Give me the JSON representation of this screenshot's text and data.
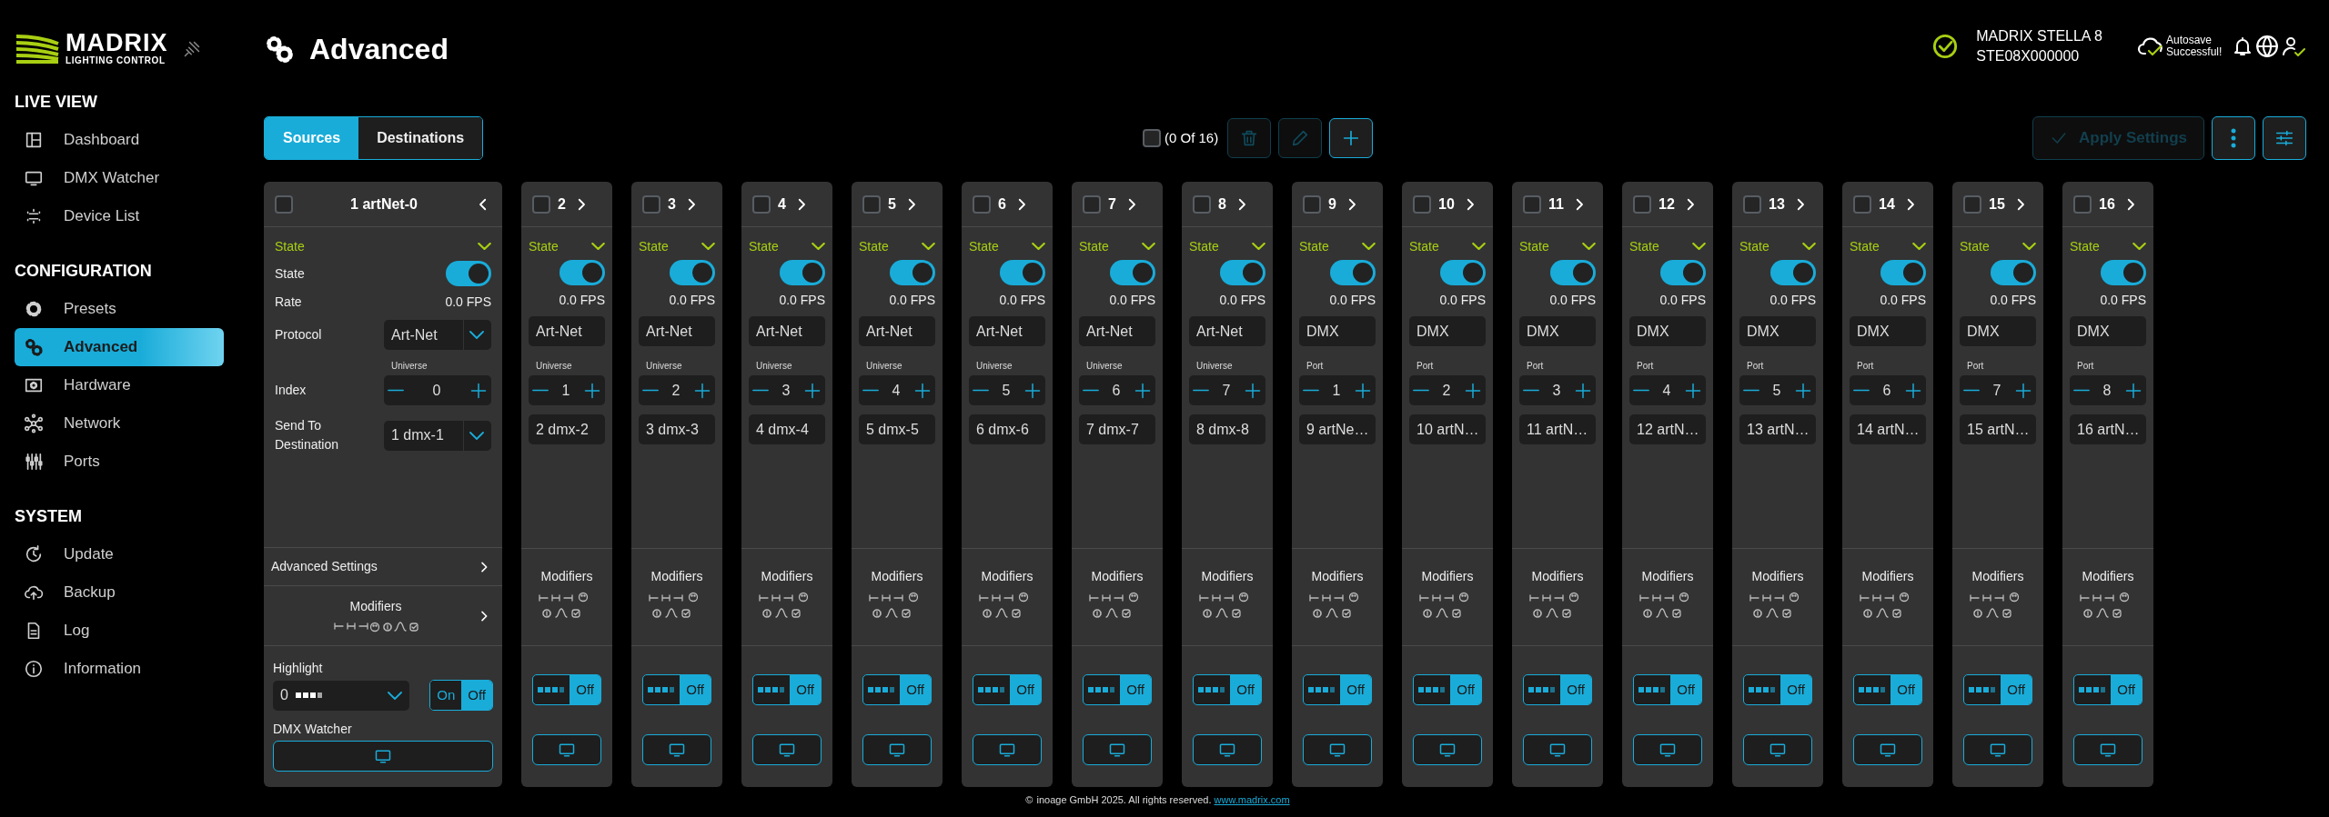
{
  "sidebar": {
    "logo": {
      "name": "MADRIX",
      "tagline": "LIGHTING CONTROL"
    },
    "sections": [
      {
        "title": "LIVE VIEW",
        "items": [
          {
            "label": "Dashboard",
            "selected": false
          },
          {
            "label": "DMX Watcher",
            "selected": false
          },
          {
            "label": "Device List",
            "selected": false
          }
        ]
      },
      {
        "title": "CONFIGURATION",
        "items": [
          {
            "label": "Presets",
            "selected": false
          },
          {
            "label": "Advanced",
            "selected": true
          },
          {
            "label": "Hardware",
            "selected": false
          },
          {
            "label": "Network",
            "selected": false
          },
          {
            "label": "Ports",
            "selected": false
          }
        ]
      },
      {
        "title": "SYSTEM",
        "items": [
          {
            "label": "Update",
            "selected": false
          },
          {
            "label": "Backup",
            "selected": false
          },
          {
            "label": "Log",
            "selected": false
          },
          {
            "label": "Information",
            "selected": false
          }
        ]
      }
    ]
  },
  "page": {
    "title": "Advanced"
  },
  "device": {
    "name": "MADRIX STELLA 8",
    "serial": "STE08X000000"
  },
  "autosave": "Autosave Successful!",
  "tabs": [
    {
      "label": "Sources",
      "selected": true
    },
    {
      "label": "Destinations",
      "selected": false
    }
  ],
  "selection": {
    "checked": false,
    "count": "(0 Of 16)"
  },
  "toolbar_buttons": [
    {
      "kind": "delete",
      "disabled": true
    },
    {
      "kind": "edit",
      "disabled": true
    },
    {
      "kind": "add",
      "disabled": false
    }
  ],
  "apply_button": {
    "label": "Apply Settings",
    "disabled": true
  },
  "columns": [
    {
      "title": "1 artNet-0",
      "expanded": true,
      "checked": false,
      "section": "State",
      "state_label": "State",
      "state_on": true,
      "rate_label": "Rate",
      "rate": "0.0 FPS",
      "protocol_label": "Protocol",
      "protocol": "Art-Net",
      "index_label": "Index",
      "index_unit": "Universe",
      "index": "0",
      "destination_label": "Send To Destination",
      "destination": "1 dmx-1",
      "advanced_label": "Advanced Settings",
      "modifiers": "Modifiers",
      "highlight_label": "Highlight",
      "highlight_value": "0",
      "highlight": [
        {
          "label": "On",
          "selected": false
        },
        {
          "label": "Off",
          "selected": true
        }
      ],
      "watcher_label": "DMX Watcher"
    },
    {
      "title": "2",
      "expanded": false,
      "checked": false,
      "section": "State",
      "state_on": true,
      "rate": "0.0 FPS",
      "protocol": "Art-Net",
      "index_unit": "Universe",
      "index": "1",
      "destination": "2 dmx-2",
      "modifiers": "Modifiers",
      "highlight": [
        {
          "label": "Off",
          "selected": true
        }
      ]
    },
    {
      "title": "3",
      "expanded": false,
      "checked": false,
      "section": "State",
      "state_on": true,
      "rate": "0.0 FPS",
      "protocol": "Art-Net",
      "index_unit": "Universe",
      "index": "2",
      "destination": "3 dmx-3",
      "modifiers": "Modifiers",
      "highlight": [
        {
          "label": "Off",
          "selected": true
        }
      ]
    },
    {
      "title": "4",
      "expanded": false,
      "checked": false,
      "section": "State",
      "state_on": true,
      "rate": "0.0 FPS",
      "protocol": "Art-Net",
      "index_unit": "Universe",
      "index": "3",
      "destination": "4 dmx-4",
      "modifiers": "Modifiers",
      "highlight": [
        {
          "label": "Off",
          "selected": true
        }
      ]
    },
    {
      "title": "5",
      "expanded": false,
      "checked": false,
      "section": "State",
      "state_on": true,
      "rate": "0.0 FPS",
      "protocol": "Art-Net",
      "index_unit": "Universe",
      "index": "4",
      "destination": "5 dmx-5",
      "modifiers": "Modifiers",
      "highlight": [
        {
          "label": "Off",
          "selected": true
        }
      ]
    },
    {
      "title": "6",
      "expanded": false,
      "checked": false,
      "section": "State",
      "state_on": true,
      "rate": "0.0 FPS",
      "protocol": "Art-Net",
      "index_unit": "Universe",
      "index": "5",
      "destination": "6 dmx-6",
      "modifiers": "Modifiers",
      "highlight": [
        {
          "label": "Off",
          "selected": true
        }
      ]
    },
    {
      "title": "7",
      "expanded": false,
      "checked": false,
      "section": "State",
      "state_on": true,
      "rate": "0.0 FPS",
      "protocol": "Art-Net",
      "index_unit": "Universe",
      "index": "6",
      "destination": "7 dmx-7",
      "modifiers": "Modifiers",
      "highlight": [
        {
          "label": "Off",
          "selected": true
        }
      ]
    },
    {
      "title": "8",
      "expanded": false,
      "checked": false,
      "section": "State",
      "state_on": true,
      "rate": "0.0 FPS",
      "protocol": "Art-Net",
      "index_unit": "Universe",
      "index": "7",
      "destination": "8 dmx-8",
      "modifiers": "Modifiers",
      "highlight": [
        {
          "label": "Off",
          "selected": true
        }
      ]
    },
    {
      "title": "9",
      "expanded": false,
      "checked": false,
      "section": "State",
      "state_on": true,
      "rate": "0.0 FPS",
      "protocol": "DMX",
      "index_unit": "Port",
      "index": "1",
      "destination": "9 artNe…",
      "modifiers": "Modifiers",
      "highlight": [
        {
          "label": "Off",
          "selected": true
        }
      ]
    },
    {
      "title": "10",
      "expanded": false,
      "checked": false,
      "section": "State",
      "state_on": true,
      "rate": "0.0 FPS",
      "protocol": "DMX",
      "index_unit": "Port",
      "index": "2",
      "destination": "10 artN…",
      "modifiers": "Modifiers",
      "highlight": [
        {
          "label": "Off",
          "selected": true
        }
      ]
    },
    {
      "title": "11",
      "expanded": false,
      "checked": false,
      "section": "State",
      "state_on": true,
      "rate": "0.0 FPS",
      "protocol": "DMX",
      "index_unit": "Port",
      "index": "3",
      "destination": "11 artN…",
      "modifiers": "Modifiers",
      "highlight": [
        {
          "label": "Off",
          "selected": true
        }
      ]
    },
    {
      "title": "12",
      "expanded": false,
      "checked": false,
      "section": "State",
      "state_on": true,
      "rate": "0.0 FPS",
      "protocol": "DMX",
      "index_unit": "Port",
      "index": "4",
      "destination": "12 artN…",
      "modifiers": "Modifiers",
      "highlight": [
        {
          "label": "Off",
          "selected": true
        }
      ]
    },
    {
      "title": "13",
      "expanded": false,
      "checked": false,
      "section": "State",
      "state_on": true,
      "rate": "0.0 FPS",
      "protocol": "DMX",
      "index_unit": "Port",
      "index": "5",
      "destination": "13 artN…",
      "modifiers": "Modifiers",
      "highlight": [
        {
          "label": "Off",
          "selected": true
        }
      ]
    },
    {
      "title": "14",
      "expanded": false,
      "checked": false,
      "section": "State",
      "state_on": true,
      "rate": "0.0 FPS",
      "protocol": "DMX",
      "index_unit": "Port",
      "index": "6",
      "destination": "14 artN…",
      "modifiers": "Modifiers",
      "highlight": [
        {
          "label": "Off",
          "selected": true
        }
      ]
    },
    {
      "title": "15",
      "expanded": false,
      "checked": false,
      "section": "State",
      "state_on": true,
      "rate": "0.0 FPS",
      "protocol": "DMX",
      "index_unit": "Port",
      "index": "7",
      "destination": "15 artN…",
      "modifiers": "Modifiers",
      "highlight": [
        {
          "label": "Off",
          "selected": true
        }
      ]
    },
    {
      "title": "16",
      "expanded": false,
      "checked": false,
      "section": "State",
      "state_on": true,
      "rate": "0.0 FPS",
      "protocol": "DMX",
      "index_unit": "Port",
      "index": "8",
      "destination": "16 artN…",
      "modifiers": "Modifiers",
      "highlight": [
        {
          "label": "Off",
          "selected": true
        }
      ]
    }
  ],
  "footer": {
    "symbol": "©",
    "text": "inoage GmbH 2025. All rights reserved.",
    "link": "www.madrix.com"
  }
}
